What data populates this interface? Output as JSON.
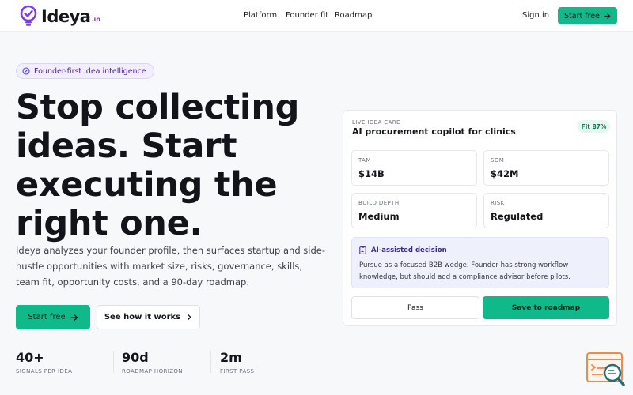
{
  "brand": {
    "name": "Ideya",
    "tld": ".in"
  },
  "nav": [
    {
      "label": "Platform"
    },
    {
      "label": "Founder fit"
    },
    {
      "label": "Roadmap"
    }
  ],
  "header": {
    "signin_label": "Sign in",
    "start_label": "Start free"
  },
  "hero": {
    "pill_text": "Founder-first idea intelligence",
    "headline_lines": [
      "Stop collecting",
      "ideas. Start",
      "executing the",
      "right one."
    ],
    "subtext": "Ideya analyzes your founder profile, then surfaces startup and side-hustle opportunities with market size, risks, governance, skills, team fit, opportunity costs, and a 90-day roadmap.",
    "primary_cta": "Start free",
    "secondary_cta": "See how it works"
  },
  "stats": [
    {
      "value": "40+",
      "label": "SIGNALS PER IDEA"
    },
    {
      "value": "90d",
      "label": "ROADMAP HORIZON"
    },
    {
      "value": "2m",
      "label": "FIRST PASS"
    }
  ],
  "card": {
    "eyebrow": "LIVE IDEA CARD",
    "title": "AI procurement copilot for clinics",
    "fit_badge": "Fit 87%",
    "metrics": [
      {
        "label": "TAM",
        "value": "$14B"
      },
      {
        "label": "SOM",
        "value": "$42M"
      },
      {
        "label": "BUILD DEPTH",
        "value": "Medium"
      },
      {
        "label": "RISK",
        "value": "Regulated"
      }
    ],
    "decision_title": "AI-assisted decision",
    "decision_text": "Pursue as a focused B2B wedge. Founder has strong workflow knowledge, but should add a compliance advisor before pilots.",
    "pass_label": "Pass",
    "save_label": "Save to roadmap"
  },
  "colors": {
    "accent": "#10b98a",
    "brand_purple": "#7c3aed",
    "text": "#14161c",
    "widget_orange": "#f08a4b",
    "widget_teal": "#1f6f78"
  },
  "icons": {
    "logo": "lightbulb-check-icon",
    "arrow": "arrow-right-icon",
    "chevron": "chevron-right-icon",
    "pill": "sparkle-circle-icon",
    "decision": "clipboard-icon",
    "widget": "magnifier-document-icon"
  }
}
